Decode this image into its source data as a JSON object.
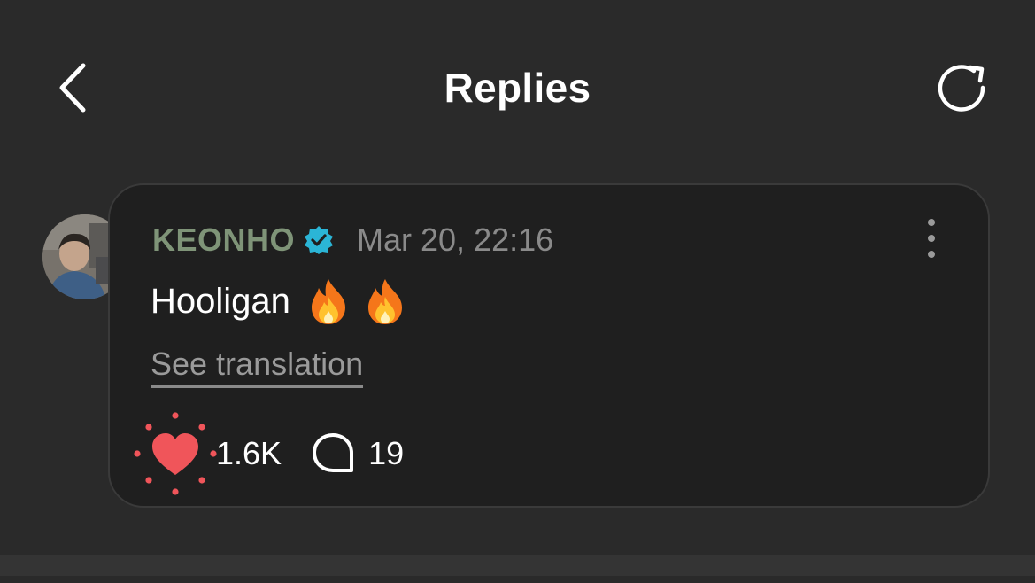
{
  "header": {
    "title": "Replies",
    "back_icon": "chevron-left-icon",
    "refresh_icon": "refresh-icon"
  },
  "reply": {
    "username": "KEONHO",
    "verified": true,
    "timestamp": "Mar 20, 22:16",
    "text": "Hooligan",
    "emojis": [
      "fire",
      "fire"
    ],
    "translation_link": "See translation",
    "likes": "1.6K",
    "liked": true,
    "comments": "19"
  },
  "colors": {
    "background": "#2a2a2a",
    "card": "#1f1f1f",
    "username": "#7f9478",
    "verified": "#2bb5d6",
    "like_active": "#f0555a"
  }
}
